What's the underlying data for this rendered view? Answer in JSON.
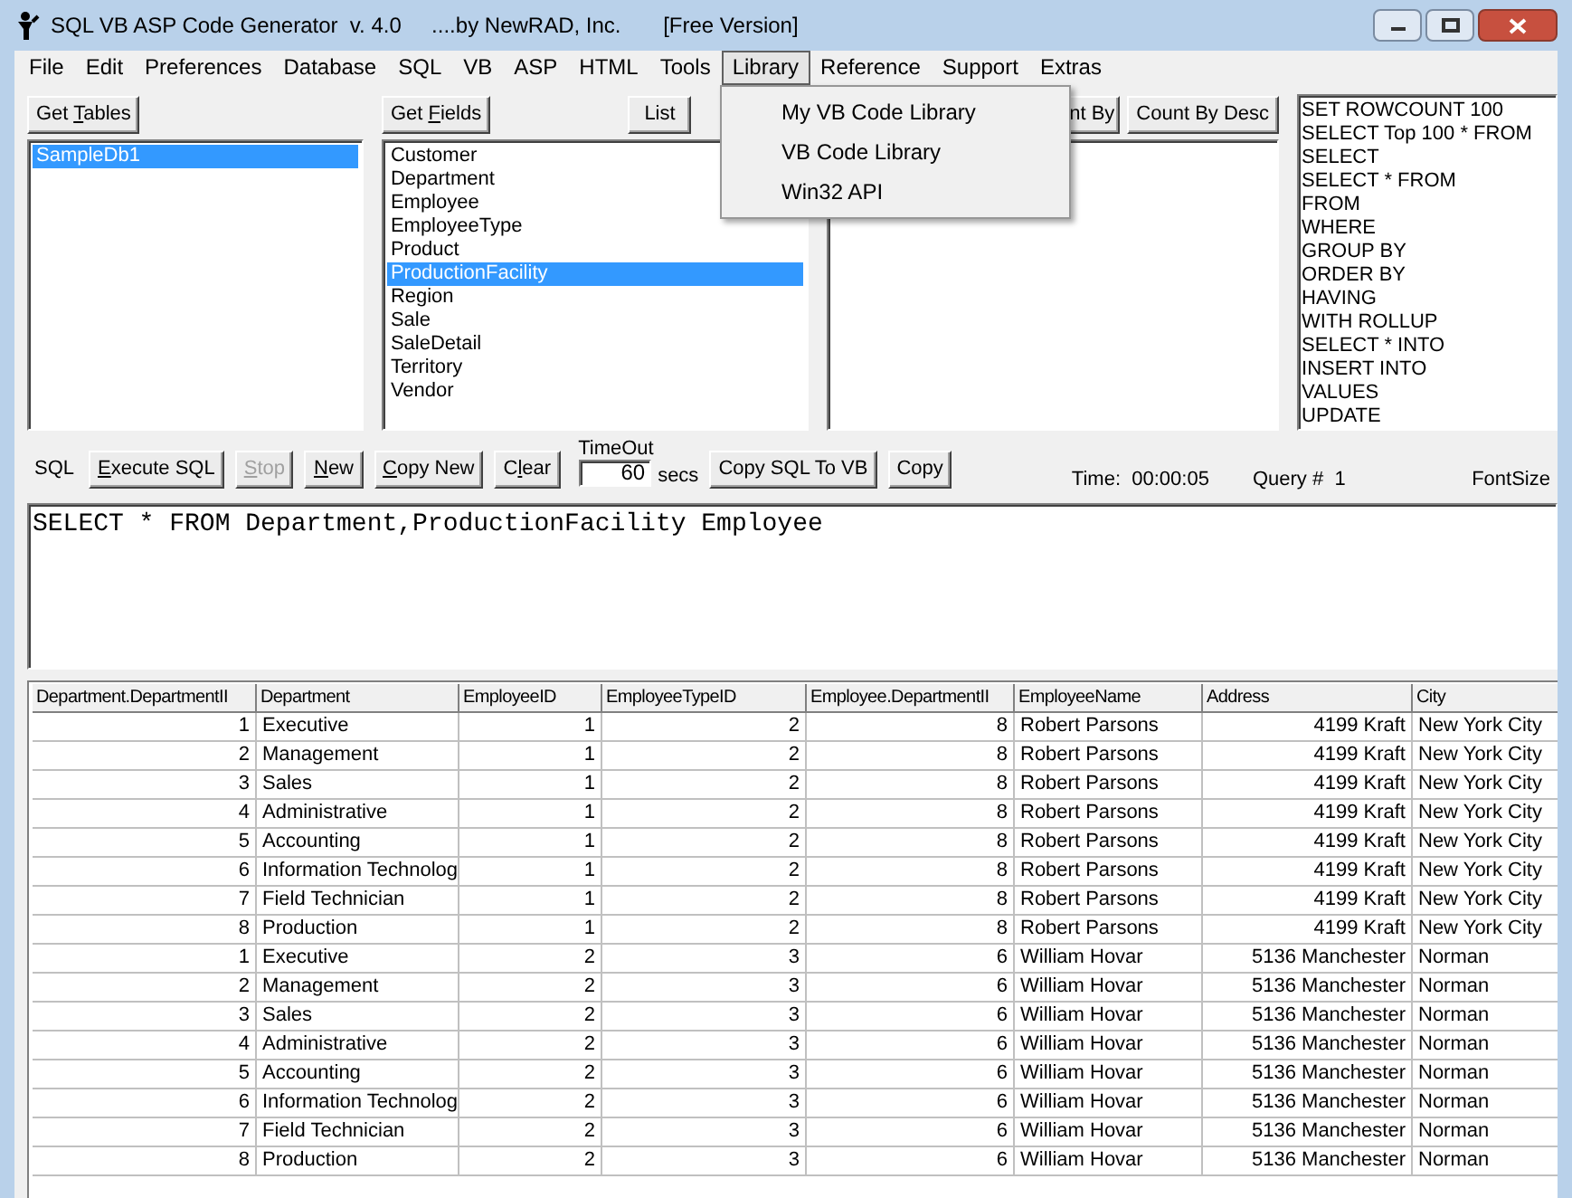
{
  "window": {
    "title": "SQL VB ASP Code Generator  v. 4.0     ....by NewRAD, Inc.       [Free Version]"
  },
  "menu": [
    {
      "label": "File",
      "selected": false
    },
    {
      "label": "Edit",
      "selected": false
    },
    {
      "label": "Preferences",
      "selected": false
    },
    {
      "label": "Database",
      "selected": false
    },
    {
      "label": "SQL",
      "selected": false
    },
    {
      "label": "VB",
      "selected": false
    },
    {
      "label": "ASP",
      "selected": false
    },
    {
      "label": "HTML",
      "selected": false
    },
    {
      "label": "Tools",
      "selected": false
    },
    {
      "label": "Library",
      "selected": true
    },
    {
      "label": "Reference",
      "selected": false
    },
    {
      "label": "Support",
      "selected": false
    },
    {
      "label": "Extras",
      "selected": false
    }
  ],
  "library_menu": [
    "My VB Code Library",
    "VB Code Library",
    "Win32 API"
  ],
  "tables": {
    "button": "Get **T**ables",
    "items": [
      {
        "label": "SampleDb1",
        "selected": true
      }
    ]
  },
  "fields": {
    "button": "Get **F**ields",
    "list_button": "List",
    "items": [
      {
        "label": "Customer",
        "selected": false
      },
      {
        "label": "Department",
        "selected": false
      },
      {
        "label": "Employee",
        "selected": false
      },
      {
        "label": "EmployeeType",
        "selected": false
      },
      {
        "label": "Product",
        "selected": false
      },
      {
        "label": "ProductionFacility",
        "selected": true
      },
      {
        "label": "Region",
        "selected": false
      },
      {
        "label": "Sale",
        "selected": false
      },
      {
        "label": "SaleDetail",
        "selected": false
      },
      {
        "label": "Territory",
        "selected": false
      },
      {
        "label": "Vendor",
        "selected": false
      }
    ]
  },
  "count_buttons": [
    "nt By",
    "Count By Desc"
  ],
  "keywords": [
    "SET ROWCOUNT 100",
    "SELECT Top 100 * FROM",
    "SELECT",
    "SELECT * FROM",
    "FROM",
    "WHERE",
    "GROUP BY",
    "ORDER BY",
    "HAVING",
    "WITH ROLLUP",
    "SELECT * INTO",
    "INSERT INTO",
    "VALUES",
    "UPDATE"
  ],
  "toolbar": {
    "sql_label": "SQL",
    "buttons": [
      {
        "label": "**E**xecute SQL",
        "disabled": false
      },
      {
        "label": "**S**top",
        "disabled": true
      },
      {
        "label": "**N**ew",
        "disabled": false
      },
      {
        "label": "**C**opy New",
        "disabled": false
      },
      {
        "label": "C**l**ear",
        "disabled": false
      }
    ],
    "timeout_label": "TimeOut",
    "timeout_value": "60",
    "timeout_unit": "secs",
    "buttons2": [
      {
        "label": "Copy SQL To VB",
        "disabled": false
      },
      {
        "label": "Copy",
        "disabled": false
      }
    ],
    "time": "Time:  00:00:05",
    "query": "Query #  1",
    "fontsize": "FontSize"
  },
  "sql_text": "SELECT * FROM Department,ProductionFacility Employee",
  "table": {
    "columns": [
      "Department.DepartmentII",
      "Department",
      "EmployeeID",
      "EmployeeTypeID",
      "Employee.DepartmentII",
      "EmployeeName",
      "Address",
      "City"
    ],
    "rows": [
      [
        "1",
        "Executive",
        "1",
        "2",
        "8",
        "Robert Parsons",
        "4199 Kraft",
        "New York City"
      ],
      [
        "2",
        "Management",
        "1",
        "2",
        "8",
        "Robert Parsons",
        "4199 Kraft",
        "New York City"
      ],
      [
        "3",
        "Sales",
        "1",
        "2",
        "8",
        "Robert Parsons",
        "4199 Kraft",
        "New York City"
      ],
      [
        "4",
        "Administrative",
        "1",
        "2",
        "8",
        "Robert Parsons",
        "4199 Kraft",
        "New York City"
      ],
      [
        "5",
        "Accounting",
        "1",
        "2",
        "8",
        "Robert Parsons",
        "4199 Kraft",
        "New York City"
      ],
      [
        "6",
        "Information Technolog",
        "1",
        "2",
        "8",
        "Robert Parsons",
        "4199 Kraft",
        "New York City"
      ],
      [
        "7",
        "Field Technician",
        "1",
        "2",
        "8",
        "Robert Parsons",
        "4199 Kraft",
        "New York City"
      ],
      [
        "8",
        "Production",
        "1",
        "2",
        "8",
        "Robert Parsons",
        "4199 Kraft",
        "New York City"
      ],
      [
        "1",
        "Executive",
        "2",
        "3",
        "6",
        "William Hovar",
        "5136 Manchester",
        "Norman"
      ],
      [
        "2",
        "Management",
        "2",
        "3",
        "6",
        "William Hovar",
        "5136 Manchester",
        "Norman"
      ],
      [
        "3",
        "Sales",
        "2",
        "3",
        "6",
        "William Hovar",
        "5136 Manchester",
        "Norman"
      ],
      [
        "4",
        "Administrative",
        "2",
        "3",
        "6",
        "William Hovar",
        "5136 Manchester",
        "Norman"
      ],
      [
        "5",
        "Accounting",
        "2",
        "3",
        "6",
        "William Hovar",
        "5136 Manchester",
        "Norman"
      ],
      [
        "6",
        "Information Technolog",
        "2",
        "3",
        "6",
        "William Hovar",
        "5136 Manchester",
        "Norman"
      ],
      [
        "7",
        "Field Technician",
        "2",
        "3",
        "6",
        "William Hovar",
        "5136 Manchester",
        "Norman"
      ],
      [
        "8",
        "Production",
        "2",
        "3",
        "6",
        "William Hovar",
        "5136 Manchester",
        "Norman"
      ]
    ]
  }
}
